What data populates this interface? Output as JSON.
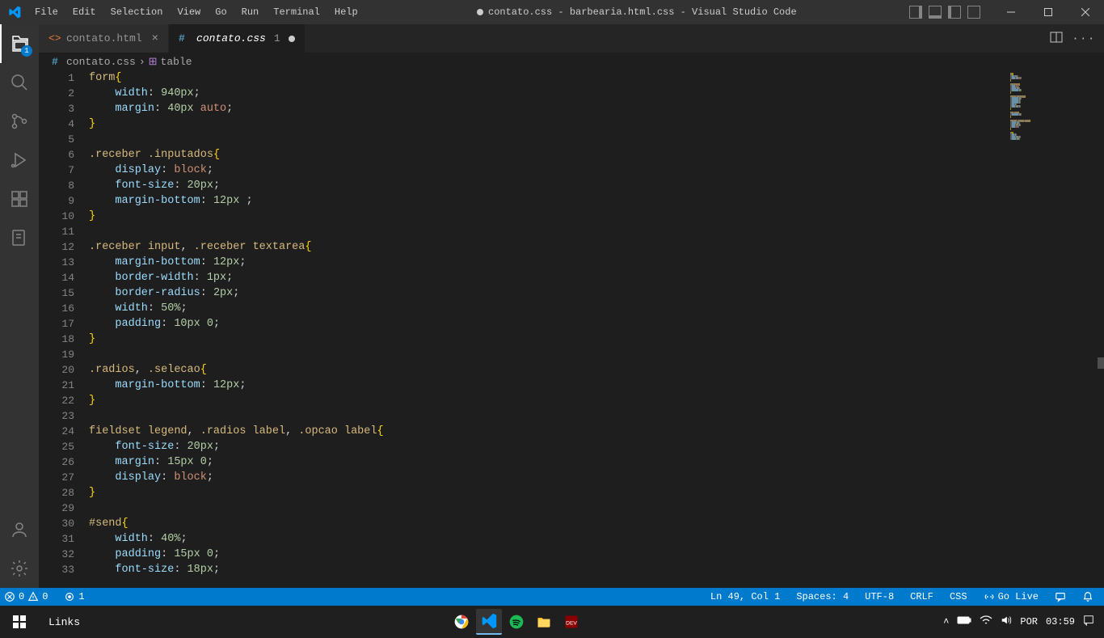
{
  "menu": [
    "File",
    "Edit",
    "Selection",
    "View",
    "Go",
    "Run",
    "Terminal",
    "Help"
  ],
  "window_title": "contato.css - barbearia.html.css - Visual Studio Code",
  "explorer_badge": "1",
  "tabs": [
    {
      "label": "contato.html",
      "icon": "html",
      "active": false,
      "dirty": false
    },
    {
      "label": "contato.css",
      "icon": "css",
      "active": true,
      "dirty": true,
      "dirty_count": "1"
    }
  ],
  "breadcrumb": {
    "file": "contato.css",
    "symbol": "table"
  },
  "code_lines": [
    [
      {
        "t": "form",
        "c": "sel"
      },
      {
        "t": "{",
        "c": "brace"
      }
    ],
    [
      {
        "t": "    "
      },
      {
        "t": "width",
        "c": "prop"
      },
      {
        "t": ": "
      },
      {
        "t": "940px",
        "c": "num"
      },
      {
        "t": ";",
        "c": "punc"
      }
    ],
    [
      {
        "t": "    "
      },
      {
        "t": "margin",
        "c": "prop"
      },
      {
        "t": ": "
      },
      {
        "t": "40px",
        "c": "num"
      },
      {
        "t": " "
      },
      {
        "t": "auto",
        "c": "kw"
      },
      {
        "t": ";",
        "c": "punc"
      }
    ],
    [
      {
        "t": "}",
        "c": "brace"
      }
    ],
    [],
    [
      {
        "t": ".receber .inputados",
        "c": "sel"
      },
      {
        "t": "{",
        "c": "brace"
      }
    ],
    [
      {
        "t": "    "
      },
      {
        "t": "display",
        "c": "prop"
      },
      {
        "t": ": "
      },
      {
        "t": "block",
        "c": "kw"
      },
      {
        "t": ";",
        "c": "punc"
      }
    ],
    [
      {
        "t": "    "
      },
      {
        "t": "font-size",
        "c": "prop"
      },
      {
        "t": ": "
      },
      {
        "t": "20px",
        "c": "num"
      },
      {
        "t": ";",
        "c": "punc"
      }
    ],
    [
      {
        "t": "    "
      },
      {
        "t": "margin-bottom",
        "c": "prop"
      },
      {
        "t": ": "
      },
      {
        "t": "12px",
        "c": "num"
      },
      {
        "t": " ;",
        "c": "punc"
      }
    ],
    [
      {
        "t": "}",
        "c": "brace"
      }
    ],
    [],
    [
      {
        "t": ".receber ",
        "c": "sel"
      },
      {
        "t": "input",
        "c": "sel"
      },
      {
        "t": ", ",
        "c": "punc"
      },
      {
        "t": ".receber ",
        "c": "sel"
      },
      {
        "t": "textarea",
        "c": "sel"
      },
      {
        "t": "{",
        "c": "brace"
      }
    ],
    [
      {
        "t": "    "
      },
      {
        "t": "margin-bottom",
        "c": "prop"
      },
      {
        "t": ": "
      },
      {
        "t": "12px",
        "c": "num"
      },
      {
        "t": ";",
        "c": "punc"
      }
    ],
    [
      {
        "t": "    "
      },
      {
        "t": "border-width",
        "c": "prop"
      },
      {
        "t": ": "
      },
      {
        "t": "1px",
        "c": "num"
      },
      {
        "t": ";",
        "c": "punc"
      }
    ],
    [
      {
        "t": "    "
      },
      {
        "t": "border-radius",
        "c": "prop"
      },
      {
        "t": ": "
      },
      {
        "t": "2px",
        "c": "num"
      },
      {
        "t": ";",
        "c": "punc"
      }
    ],
    [
      {
        "t": "    "
      },
      {
        "t": "width",
        "c": "prop"
      },
      {
        "t": ": "
      },
      {
        "t": "50%",
        "c": "num"
      },
      {
        "t": ";",
        "c": "punc"
      }
    ],
    [
      {
        "t": "    "
      },
      {
        "t": "padding",
        "c": "prop"
      },
      {
        "t": ": "
      },
      {
        "t": "10px",
        "c": "num"
      },
      {
        "t": " "
      },
      {
        "t": "0",
        "c": "num"
      },
      {
        "t": ";",
        "c": "punc"
      }
    ],
    [
      {
        "t": "}",
        "c": "brace"
      }
    ],
    [],
    [
      {
        "t": ".radios",
        "c": "sel"
      },
      {
        "t": ", ",
        "c": "punc"
      },
      {
        "t": ".selecao",
        "c": "sel"
      },
      {
        "t": "{",
        "c": "brace"
      }
    ],
    [
      {
        "t": "    "
      },
      {
        "t": "margin-bottom",
        "c": "prop"
      },
      {
        "t": ": "
      },
      {
        "t": "12px",
        "c": "num"
      },
      {
        "t": ";",
        "c": "punc"
      }
    ],
    [
      {
        "t": "}",
        "c": "brace"
      }
    ],
    [],
    [
      {
        "t": "fieldset legend",
        "c": "sel"
      },
      {
        "t": ", ",
        "c": "punc"
      },
      {
        "t": ".radios ",
        "c": "sel"
      },
      {
        "t": "label",
        "c": "sel"
      },
      {
        "t": ", ",
        "c": "punc"
      },
      {
        "t": ".opcao ",
        "c": "sel"
      },
      {
        "t": "label",
        "c": "sel"
      },
      {
        "t": "{",
        "c": "brace"
      }
    ],
    [
      {
        "t": "    "
      },
      {
        "t": "font-size",
        "c": "prop"
      },
      {
        "t": ": "
      },
      {
        "t": "20px",
        "c": "num"
      },
      {
        "t": ";",
        "c": "punc"
      }
    ],
    [
      {
        "t": "    "
      },
      {
        "t": "margin",
        "c": "prop"
      },
      {
        "t": ": "
      },
      {
        "t": "15px",
        "c": "num"
      },
      {
        "t": " "
      },
      {
        "t": "0",
        "c": "num"
      },
      {
        "t": ";",
        "c": "punc"
      }
    ],
    [
      {
        "t": "    "
      },
      {
        "t": "display",
        "c": "prop"
      },
      {
        "t": ": "
      },
      {
        "t": "block",
        "c": "kw"
      },
      {
        "t": ";",
        "c": "punc"
      }
    ],
    [
      {
        "t": "}",
        "c": "brace"
      }
    ],
    [],
    [
      {
        "t": "#send",
        "c": "sel"
      },
      {
        "t": "{",
        "c": "brace"
      }
    ],
    [
      {
        "t": "    "
      },
      {
        "t": "width",
        "c": "prop"
      },
      {
        "t": ": "
      },
      {
        "t": "40%",
        "c": "num"
      },
      {
        "t": ";",
        "c": "punc"
      }
    ],
    [
      {
        "t": "    "
      },
      {
        "t": "padding",
        "c": "prop"
      },
      {
        "t": ": "
      },
      {
        "t": "15px",
        "c": "num"
      },
      {
        "t": " "
      },
      {
        "t": "0",
        "c": "num"
      },
      {
        "t": ";",
        "c": "punc"
      }
    ],
    [
      {
        "t": "    "
      },
      {
        "t": "font-size",
        "c": "prop"
      },
      {
        "t": ": "
      },
      {
        "t": "18px",
        "c": "num"
      },
      {
        "t": ";",
        "c": "punc"
      }
    ]
  ],
  "status": {
    "errors": "0",
    "warnings": "0",
    "port": "1",
    "ln_col": "Ln 49, Col 1",
    "spaces": "Spaces: 4",
    "encoding": "UTF-8",
    "eol": "CRLF",
    "lang": "CSS",
    "golive": "Go Live"
  },
  "taskbar": {
    "links_label": "Links",
    "lang": "POR",
    "time": "03:59"
  }
}
